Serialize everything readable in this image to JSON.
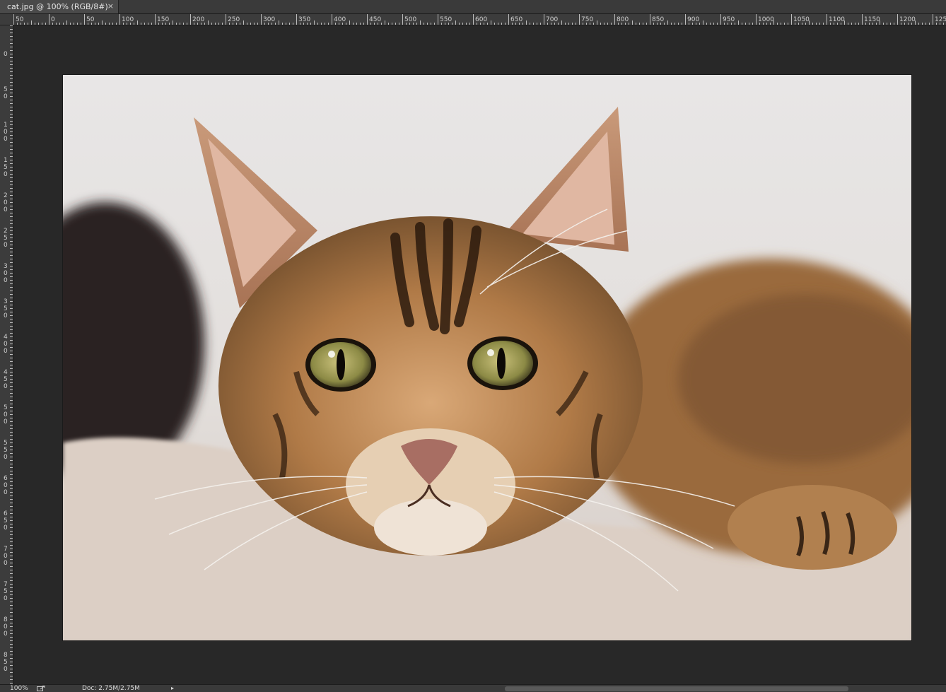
{
  "document_tab": {
    "title": "cat.jpg @ 100% (RGB/8#)",
    "close_glyph": "×"
  },
  "rulers": {
    "top_labels": [
      "50",
      "0",
      "50",
      "100",
      "150",
      "200",
      "250",
      "300",
      "350",
      "400",
      "450",
      "500",
      "550",
      "600",
      "650",
      "700",
      "750",
      "800",
      "850",
      "900",
      "950",
      "1000",
      "1050",
      "1100",
      "1150",
      "1200",
      "125"
    ],
    "left_labels": [
      "0",
      "50",
      "100",
      "150",
      "200",
      "250",
      "300",
      "350",
      "400",
      "450",
      "500",
      "550",
      "600",
      "650",
      "700",
      "750",
      "800",
      "850"
    ]
  },
  "canvas": {
    "image_name": "cat.jpg",
    "icon": "cat-photo-image"
  },
  "status_bar": {
    "zoom": "100%",
    "doc_info": "Doc: 2.75M/2.75M",
    "arrow_glyph": "▸",
    "share_icon": "share-icon"
  },
  "colors": {
    "workspace": "#282828",
    "ruler": "#3c3c3c",
    "tab_active": "#4a4a4a"
  }
}
